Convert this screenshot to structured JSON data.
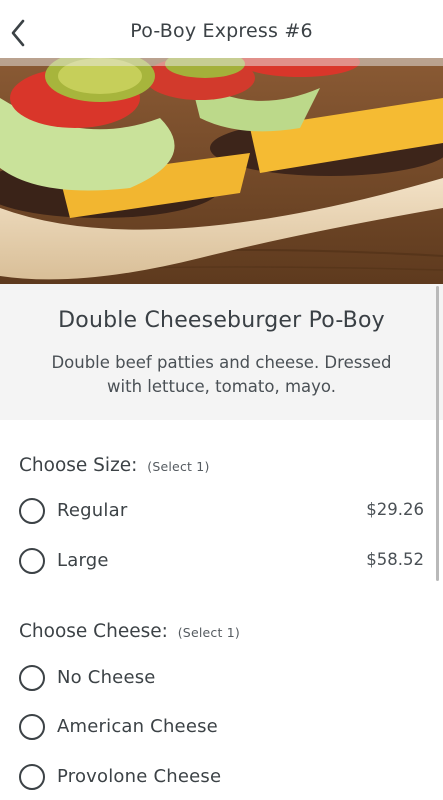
{
  "header": {
    "title": "Po-Boy Express #6",
    "back_icon": "chevron-left-icon"
  },
  "item": {
    "name": "Double Cheeseburger Po-Boy",
    "description": "Double beef patties and cheese. Dressed with lettuce, tomato, mayo."
  },
  "size_section": {
    "title": "Choose Size:",
    "hint": "(Select 1)",
    "options": [
      {
        "label": "Regular",
        "price": "$29.26"
      },
      {
        "label": "Large",
        "price": "$58.52"
      }
    ]
  },
  "cheese_section": {
    "title": "Choose Cheese:",
    "hint": "(Select 1)",
    "options": [
      {
        "label": "No Cheese"
      },
      {
        "label": "American Cheese"
      },
      {
        "label": "Provolone Cheese"
      }
    ]
  }
}
